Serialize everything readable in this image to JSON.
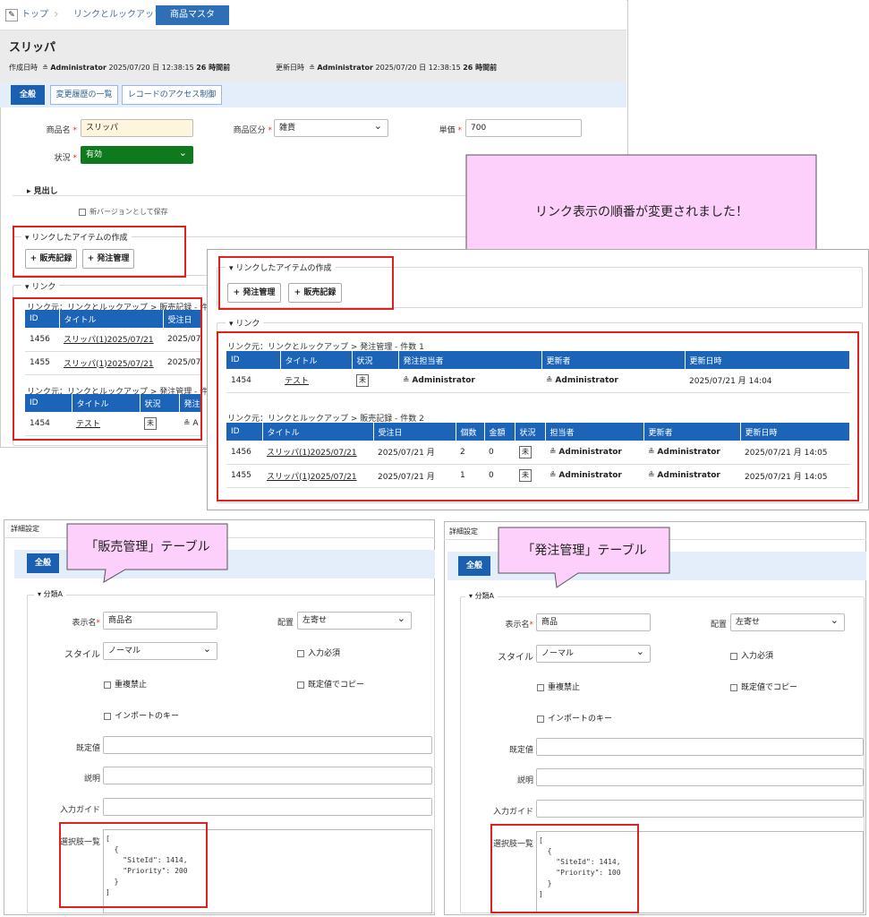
{
  "breadcrumb": {
    "home": "トップ",
    "site": "リンクとルックアップ",
    "current": "商品マスタ"
  },
  "record": {
    "title": "スリッパ",
    "created_label": "作成日時",
    "creator": "Administrator",
    "created_at": "2025/07/20 日 12:38:15",
    "created_ago": "26 時間前",
    "updated_label": "更新日時",
    "updater": "Administrator",
    "updated_at": "2025/07/20 日 12:38:15",
    "updated_ago": "26 時間前"
  },
  "tabs": [
    "全般",
    "変更履歴の一覧",
    "レコードのアクセス制御"
  ],
  "fields": {
    "name_label": "商品名",
    "name_value": "スリッパ",
    "category_label": "商品区分",
    "category_value": "雑貨",
    "price_label": "単価",
    "price_value": "700",
    "status_label": "状況",
    "status_value": "有効"
  },
  "heading_label": "見出し",
  "new_version_label": "新バージョンとして保存",
  "link_create": {
    "legend": "リンクしたアイテムの作成",
    "btn_sales": "販売記録",
    "btn_order": "発注管理"
  },
  "links": {
    "legend": "リンク",
    "sales_caption": "リンク元：リンクとルックアップ > 販売記録 - 件数",
    "order_caption": "リンク元：リンクとルックアップ > 発注管理 - 件数",
    "sales_cols": [
      "ID",
      "タイトル",
      "受注日"
    ],
    "sales_rows": [
      [
        "1456",
        "スリッパ(1)2025/07/21",
        "2025/07/"
      ],
      [
        "1455",
        "スリッパ(1)2025/07/21",
        "2025/07/"
      ]
    ],
    "order_cols": [
      "ID",
      "タイトル",
      "状況",
      "発注"
    ],
    "order_rows": [
      [
        "1454",
        "テスト",
        "未",
        "≗ A"
      ]
    ]
  },
  "callout_text": "リンク表示の順番が変更されました！",
  "panel2": {
    "create_legend": "リンクしたアイテムの作成",
    "btn_order": "発注管理",
    "btn_sales": "販売記録",
    "link_legend": "リンク",
    "order_caption": "リンク元：リンクとルックアップ > 発注管理 - 件数 1",
    "order_cols": [
      "ID",
      "タイトル",
      "状況",
      "発注担当者",
      "更新者",
      "更新日時"
    ],
    "order_rows": [
      [
        "1454",
        "テスト",
        "未",
        "Administrator",
        "Administrator",
        "2025/07/21 月 14:04"
      ]
    ],
    "sales_caption": "リンク元：リンクとルックアップ > 販売記録 - 件数 2",
    "sales_cols": [
      "ID",
      "タイトル",
      "受注日",
      "個数",
      "金額",
      "状況",
      "担当者",
      "更新者",
      "更新日時"
    ],
    "sales_rows": [
      [
        "1456",
        "スリッパ(1)2025/07/21",
        "2025/07/21 月",
        "2",
        "0",
        "未",
        "Administrator",
        "Administrator",
        "2025/07/21 月 14:05"
      ],
      [
        "1455",
        "スリッパ(1)2025/07/21",
        "2025/07/21 月",
        "1",
        "0",
        "未",
        "Administrator",
        "Administrator",
        "2025/07/21 月 14:05"
      ]
    ]
  },
  "left_settings": {
    "header": "詳細設定",
    "callout": "「販売管理」テーブル",
    "tab": "全般",
    "legend": "分類A",
    "display_name_label": "表示名",
    "display_name": "商品名",
    "placement_label": "配置",
    "placement": "左寄せ",
    "style_label": "スタイル",
    "style": "ノーマル",
    "required": "入力必須",
    "no_dup": "重複禁止",
    "copy_default": "既定値でコピー",
    "import_key": "インポートのキー",
    "default_label": "既定値",
    "desc_label": "説明",
    "guide_label": "入力ガイド",
    "choices_label": "選択肢一覧",
    "choices": "[\n  {\n    \"SiteId\": 1414,\n    \"Priority\": 200\n  }\n]"
  },
  "right_settings": {
    "header": "詳細設定",
    "callout": "「発注管理」テーブル",
    "tab": "全般",
    "legend": "分類A",
    "display_name_label": "表示名",
    "display_name": "商品",
    "placement_label": "配置",
    "placement": "左寄せ",
    "style_label": "スタイル",
    "style": "ノーマル",
    "required": "入力必須",
    "no_dup": "重複禁止",
    "copy_default": "既定値でコピー",
    "import_key": "インポートのキー",
    "default_label": "既定値",
    "desc_label": "説明",
    "guide_label": "入力ガイド",
    "choices_label": "選択肢一覧",
    "choices": "[\n  {\n    \"SiteId\": 1414,\n    \"Priority\": 100\n  }\n]"
  }
}
